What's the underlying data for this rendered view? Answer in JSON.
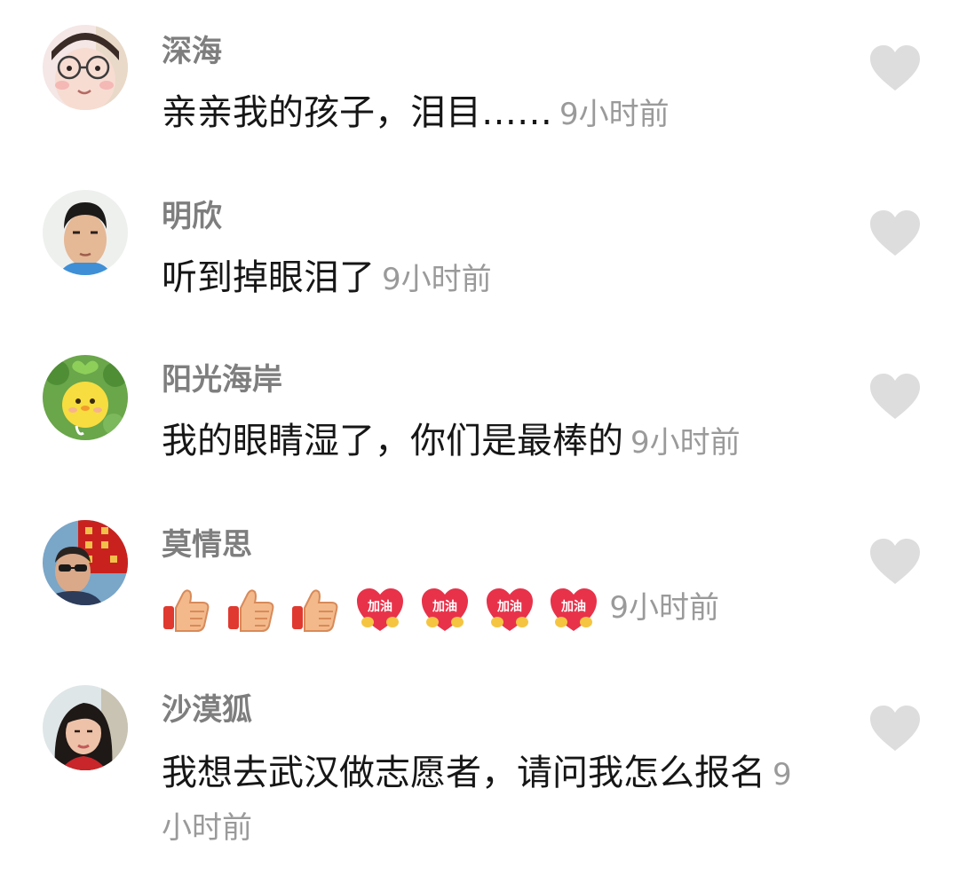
{
  "colors": {
    "username": "#7e7e7e",
    "comment_text": "#161616",
    "timestamp": "#9a9a9a",
    "like_icon": "#dddddd",
    "thumb": "#f3b98a",
    "heart_badge": "#e8324a",
    "background": "#ffffff"
  },
  "comments": [
    {
      "username": "深海",
      "text": "亲亲我的孩子，泪目……",
      "time": "9小时前",
      "avatar_icon": "baby-photo-avatar",
      "like_icon": "heart-icon"
    },
    {
      "username": "明欣",
      "text": "听到掉眼泪了",
      "time": "9小时前",
      "avatar_icon": "man-photo-avatar",
      "like_icon": "heart-icon"
    },
    {
      "username": "阳光海岸",
      "text": "我的眼睛湿了，你们是最棒的",
      "time": "9小时前",
      "avatar_icon": "yellow-chick-cartoon-avatar",
      "like_icon": "heart-icon"
    },
    {
      "username": "莫情思",
      "text": "",
      "emojis": [
        {
          "icon": "thumbs-up-emoji"
        },
        {
          "icon": "thumbs-up-emoji"
        },
        {
          "icon": "thumbs-up-emoji"
        },
        {
          "icon": "jiayou-heart-emoji",
          "label": "加油"
        },
        {
          "icon": "jiayou-heart-emoji",
          "label": "加油"
        },
        {
          "icon": "jiayou-heart-emoji",
          "label": "加油"
        },
        {
          "icon": "jiayou-heart-emoji",
          "label": "加油"
        }
      ],
      "time": "9小时前",
      "avatar_icon": "man-sunglasses-photo-avatar",
      "like_icon": "heart-icon"
    },
    {
      "username": "沙漠狐",
      "text": "我想去武汉做志愿者，请问我怎么报名",
      "time": "9小时前",
      "avatar_icon": "woman-photo-avatar",
      "like_icon": "heart-icon"
    }
  ]
}
